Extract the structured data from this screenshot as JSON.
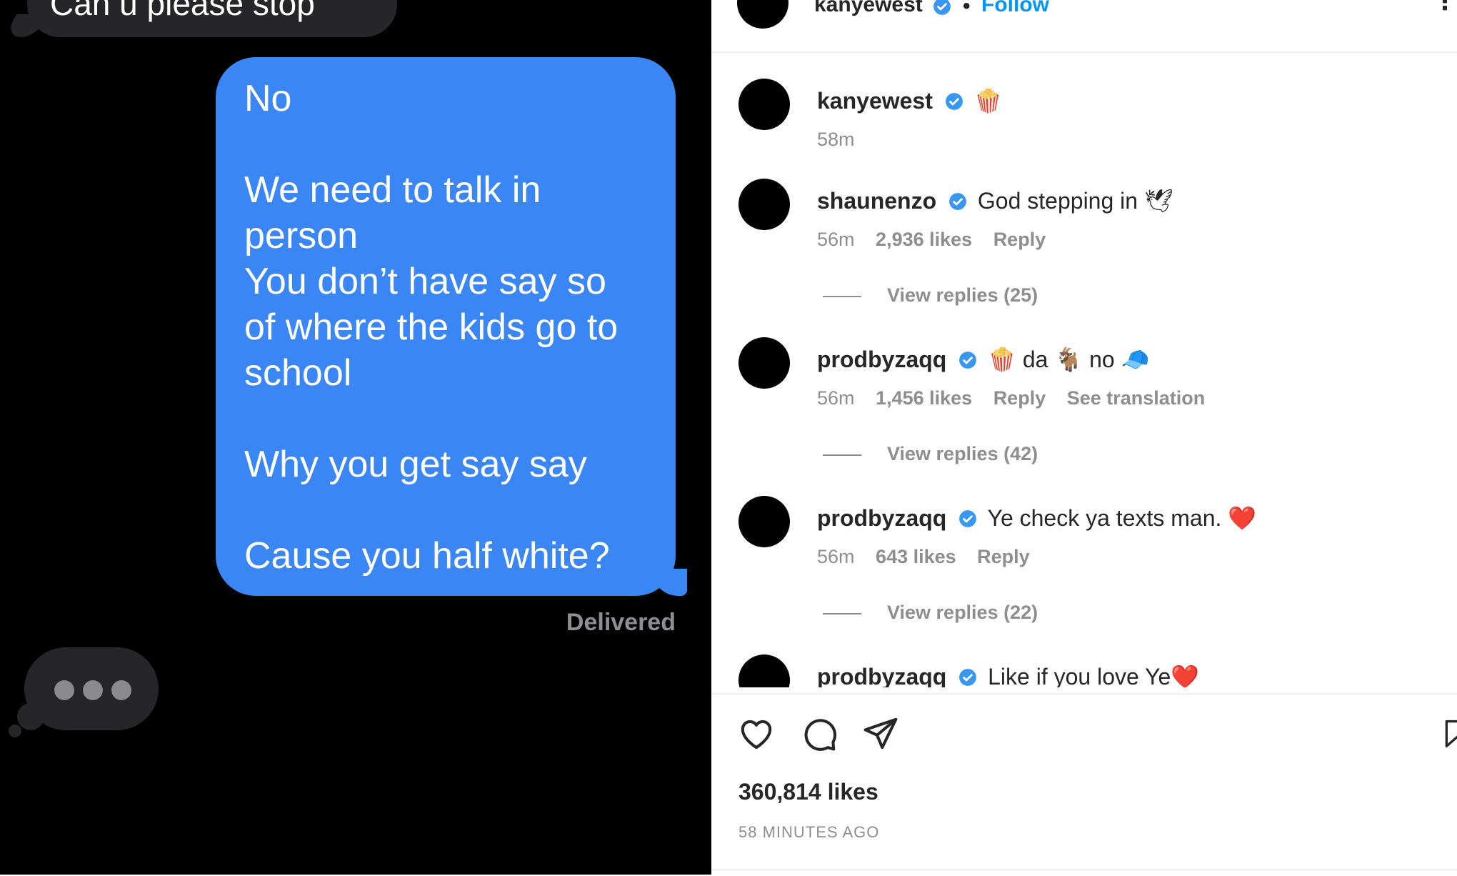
{
  "imessage": {
    "top_message": "Can u please stop",
    "sent_message_lines": [
      "No",
      "",
      "We need to talk in",
      "person",
      "You don’t have say so",
      "of where the kids go to",
      "school",
      "",
      "Why you get say say",
      "",
      "Cause you half white?"
    ],
    "status": "Delivered",
    "bubble_color": "#3b86f5"
  },
  "instagram": {
    "header": {
      "username": "kanyewest",
      "separator": "•",
      "follow_label": "Follow",
      "more_label": "⋮"
    },
    "caption": {
      "username": "kanyewest",
      "emoji": "🍿",
      "time": "58m"
    },
    "comments": [
      {
        "username": "shaunenzo",
        "text": "God stepping in 🕊",
        "time": "56m",
        "likes": "2,936 likes",
        "reply": "Reply",
        "view_replies": "View replies (25)"
      },
      {
        "username": "prodbyzaqq",
        "text": "🍿 da 🐐 no 🧢",
        "time": "56m",
        "likes": "1,456 likes",
        "reply": "Reply",
        "translate": "See translation",
        "view_replies": "View replies (42)"
      },
      {
        "username": "prodbyzaqq",
        "text": "Ye check ya texts man. ❤️",
        "time": "56m",
        "likes": "643 likes",
        "reply": "Reply",
        "view_replies": "View replies (22)"
      },
      {
        "username": "prodbyzaqq",
        "text": "Like if you love Ye❤️"
      }
    ],
    "actions": [
      "heart-icon",
      "comment-icon",
      "share-icon",
      "save-icon"
    ],
    "likes_total": "360,814 likes",
    "posted_ago": "58 MINUTES AGO",
    "verified_color": "#3897f0",
    "follow_color": "#0095f6"
  }
}
